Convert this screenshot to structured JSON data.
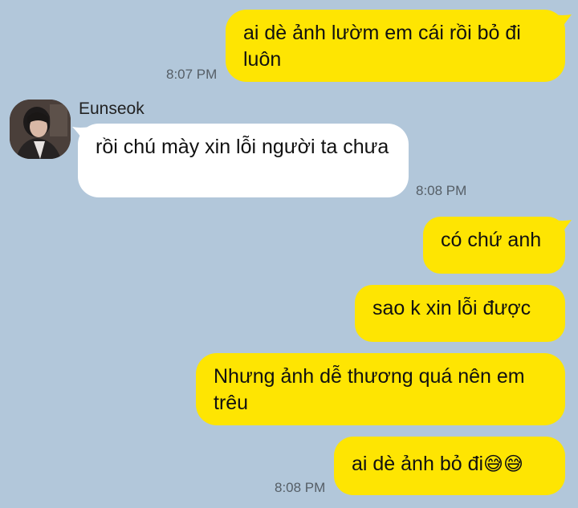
{
  "messages": [
    {
      "side": "me",
      "text": "ai dè ảnh lườm em cái rồi bỏ đi luôn",
      "time": "8:07 PM"
    },
    {
      "side": "them",
      "sender": "Eunseok",
      "text": "rồi chú mày xin lỗi người ta chưa",
      "time": "8:08 PM"
    },
    {
      "side": "me",
      "text": "có chứ anh"
    },
    {
      "side": "me",
      "text": "sao k xin lỗi được"
    },
    {
      "side": "me",
      "text": "Nhưng ảnh dễ thương quá nên em trêu"
    },
    {
      "side": "me",
      "text": "ai dè ảnh bỏ đi",
      "emoji": "😅😅",
      "time": "8:08 PM"
    }
  ],
  "colors": {
    "background": "#b2c7da",
    "my_bubble": "#fee502",
    "their_bubble": "#ffffff"
  },
  "icons": {
    "avatar": "profile-photo"
  }
}
